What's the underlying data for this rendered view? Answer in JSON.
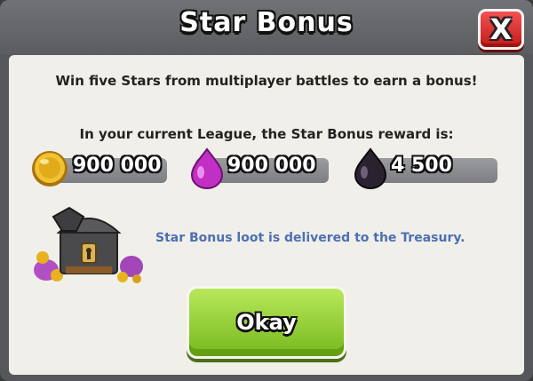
{
  "dialog": {
    "title": "Star Bonus",
    "close_label": "X",
    "line1": "Win five Stars from multiplayer battles to earn a bonus!",
    "line2": "In your current League, the Star Bonus reward is:",
    "rewards": [
      {
        "icon": "gold-coin-icon",
        "value": "900 000",
        "color": "#e8b21f"
      },
      {
        "icon": "elixir-drop-icon",
        "value": "900 000",
        "color": "#d438d6"
      },
      {
        "icon": "dark-elixir-drop-icon",
        "value": "4 500",
        "color": "#2d2233"
      }
    ],
    "info": "Star Bonus loot is delivered to the Treasury.",
    "okay_label": "Okay"
  },
  "colors": {
    "frame": "#55575b",
    "panel": "#f0efe9",
    "close_button": "#d82a2a",
    "okay_button": "#8fcb2d",
    "info_text": "#4d6fb3"
  }
}
